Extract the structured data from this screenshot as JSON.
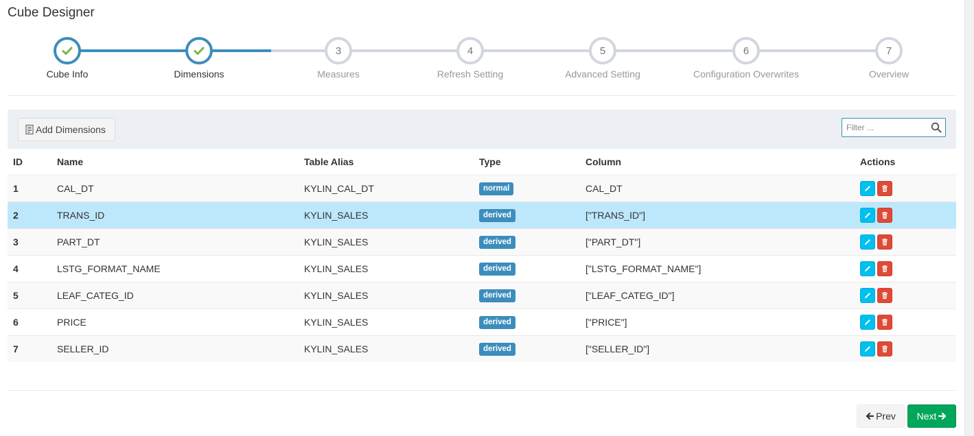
{
  "page": {
    "title": "Cube Designer"
  },
  "wizard": {
    "steps": [
      {
        "number": "1",
        "label": "Cube Info",
        "state": "done"
      },
      {
        "number": "2",
        "label": "Dimensions",
        "state": "done"
      },
      {
        "number": "3",
        "label": "Measures",
        "state": "pending"
      },
      {
        "number": "4",
        "label": "Refresh Setting",
        "state": "pending"
      },
      {
        "number": "5",
        "label": "Advanced Setting",
        "state": "pending"
      },
      {
        "number": "6",
        "label": "Configuration Overwrites",
        "state": "pending"
      },
      {
        "number": "7",
        "label": "Overview",
        "state": "pending"
      }
    ]
  },
  "toolbar": {
    "add_label": "Add Dimensions",
    "filter_placeholder": "Filter ...",
    "filter_value": ""
  },
  "table": {
    "headers": {
      "id": "ID",
      "name": "Name",
      "alias": "Table Alias",
      "type": "Type",
      "column": "Column",
      "actions": "Actions"
    },
    "rows": [
      {
        "id": "1",
        "name": "CAL_DT",
        "alias": "KYLIN_CAL_DT",
        "type": "normal",
        "column": "CAL_DT"
      },
      {
        "id": "2",
        "name": "TRANS_ID",
        "alias": "KYLIN_SALES",
        "type": "derived",
        "column": "[\"TRANS_ID\"]"
      },
      {
        "id": "3",
        "name": "PART_DT",
        "alias": "KYLIN_SALES",
        "type": "derived",
        "column": "[\"PART_DT\"]"
      },
      {
        "id": "4",
        "name": "LSTG_FORMAT_NAME",
        "alias": "KYLIN_SALES",
        "type": "derived",
        "column": "[\"LSTG_FORMAT_NAME\"]"
      },
      {
        "id": "5",
        "name": "LEAF_CATEG_ID",
        "alias": "KYLIN_SALES",
        "type": "derived",
        "column": "[\"LEAF_CATEG_ID\"]"
      },
      {
        "id": "6",
        "name": "PRICE",
        "alias": "KYLIN_SALES",
        "type": "derived",
        "column": "[\"PRICE\"]"
      },
      {
        "id": "7",
        "name": "SELLER_ID",
        "alias": "KYLIN_SALES",
        "type": "derived",
        "column": "[\"SELLER_ID\"]"
      }
    ]
  },
  "nav": {
    "prev_label": "Prev",
    "next_label": "Next"
  },
  "colors": {
    "accent": "#3c8dbc",
    "edit": "#00c0ef",
    "delete": "#dd4b39",
    "next": "#00a65a",
    "highlight_row": "#bde8fb"
  }
}
